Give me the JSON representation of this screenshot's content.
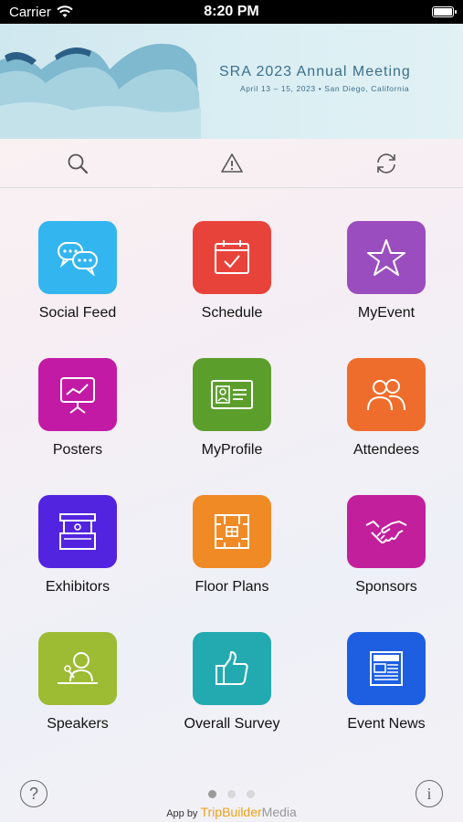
{
  "status_bar": {
    "carrier": "Carrier",
    "time": "8:20 PM"
  },
  "banner": {
    "title": "SRA 2023 Annual Meeting",
    "subtitle": "April 13 – 15, 2023  •  San Diego, California"
  },
  "toolbar": {
    "search_icon": "search-icon",
    "alert_icon": "warning-icon",
    "refresh_icon": "refresh-icon"
  },
  "tiles": [
    {
      "label": "Social Feed",
      "color": "#33b5f0",
      "icon": "chat-bubbles-icon"
    },
    {
      "label": "Schedule",
      "color": "#e8433b",
      "icon": "calendar-check-icon"
    },
    {
      "label": "MyEvent",
      "color": "#9a4dbf",
      "icon": "star-icon"
    },
    {
      "label": "Posters",
      "color": "#c21aa4",
      "icon": "presentation-board-icon"
    },
    {
      "label": "MyProfile",
      "color": "#5c9e2c",
      "icon": "id-card-icon"
    },
    {
      "label": "Attendees",
      "color": "#ef6d2c",
      "icon": "people-icon"
    },
    {
      "label": "Exhibitors",
      "color": "#5224e0",
      "icon": "booth-icon"
    },
    {
      "label": "Floor Plans",
      "color": "#ef8a25",
      "icon": "floor-plan-icon"
    },
    {
      "label": "Sponsors",
      "color": "#c21f9c",
      "icon": "handshake-icon"
    },
    {
      "label": "Speakers",
      "color": "#9dbb33",
      "icon": "speaker-podium-icon"
    },
    {
      "label": "Overall Survey",
      "color": "#22aab0",
      "icon": "thumbs-up-icon"
    },
    {
      "label": "Event News",
      "color": "#1d5fe0",
      "icon": "newspaper-icon"
    }
  ],
  "footer": {
    "help_label": "?",
    "info_label": "i",
    "credit_prefix": "App by",
    "brand_a": "TripBuilder",
    "brand_b": "Media",
    "page_dots": 3,
    "active_page": 1
  }
}
